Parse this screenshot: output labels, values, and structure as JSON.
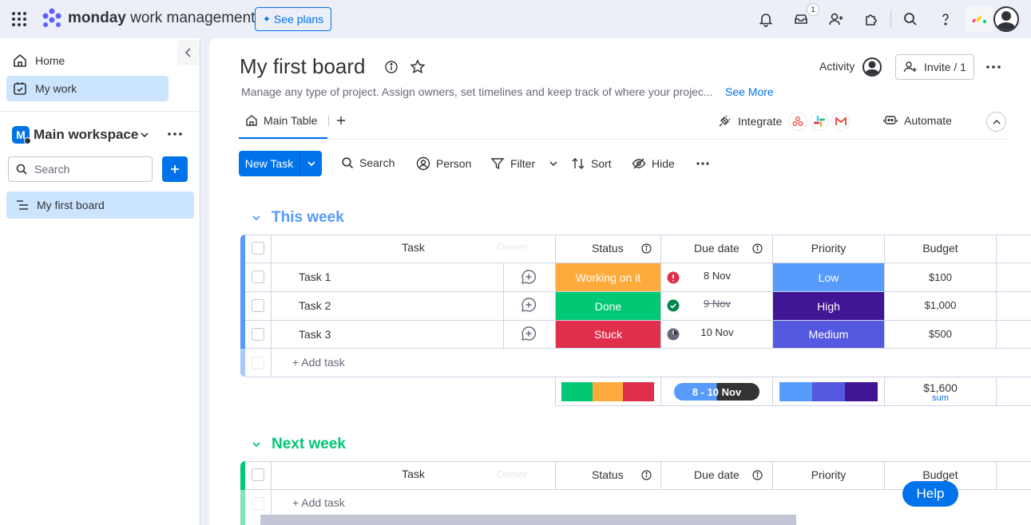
{
  "topbar": {
    "logo_brand": "monday",
    "logo_product": "work management",
    "see_plans": "See plans",
    "inbox_badge": "1"
  },
  "sidebar": {
    "home": "Home",
    "my_work": "My work",
    "workspace_initial": "M",
    "workspace_name": "Main workspace",
    "search_placeholder": "Search",
    "board_item": "My first board"
  },
  "board": {
    "title": "My first board",
    "description": "Manage any type of project. Assign owners, set timelines and keep track of where your projec...",
    "see_more": "See More",
    "activity": "Activity",
    "invite": "Invite / 1",
    "tab_main": "Main Table",
    "integrate": "Integrate",
    "automate": "Automate"
  },
  "toolbar": {
    "new_task": "New Task",
    "search": "Search",
    "person": "Person",
    "filter": "Filter",
    "sort": "Sort",
    "hide": "Hide"
  },
  "columns": {
    "task": "Task",
    "owner": "Owner",
    "status": "Status",
    "due_date": "Due date",
    "priority": "Priority",
    "budget": "Budget"
  },
  "groups": [
    {
      "title": "This week",
      "color": "#579bfc",
      "rows": [
        {
          "name": "Task 1",
          "status": "Working on it",
          "status_color": "#fdab3d",
          "due": "8 Nov",
          "due_state": "overdue",
          "priority": "Low",
          "priority_color": "#579bfc",
          "budget": "$100"
        },
        {
          "name": "Task 2",
          "status": "Done",
          "status_color": "#00c875",
          "due": "9 Nov",
          "due_state": "done",
          "priority": "High",
          "priority_color": "#401694",
          "budget": "$1,000"
        },
        {
          "name": "Task 3",
          "status": "Stuck",
          "status_color": "#df2f4a",
          "due": "10 Nov",
          "due_state": "pending",
          "priority": "Medium",
          "priority_color": "#5559df",
          "budget": "$500"
        }
      ],
      "add_task": "+ Add task",
      "summary": {
        "status_bars": [
          "#00c875",
          "#fdab3d",
          "#df2f4a"
        ],
        "due_range": "8 - 10 Nov",
        "priority_bars": [
          "#579bfc",
          "#5559df",
          "#401694"
        ],
        "budget_sum": "$1,600",
        "budget_sum_label": "sum"
      }
    },
    {
      "title": "Next week",
      "color": "#00c875",
      "rows": [],
      "add_task": "+ Add task"
    }
  ],
  "help": "Help"
}
